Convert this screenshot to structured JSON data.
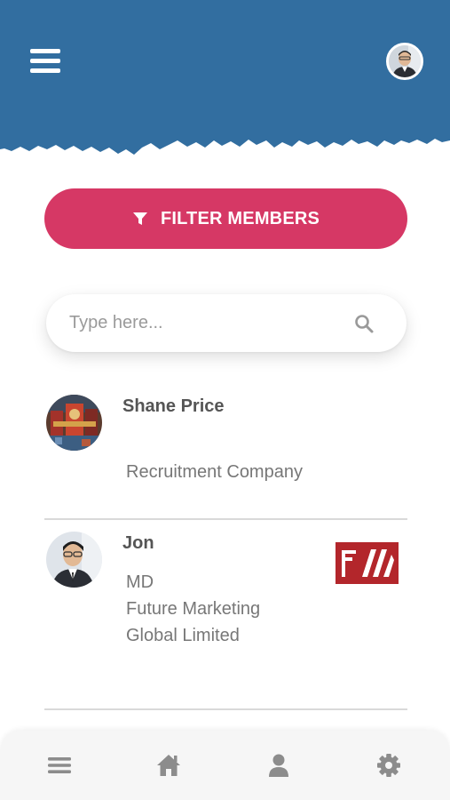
{
  "header": {
    "menu_icon": "hamburger-menu-icon",
    "avatar_icon": "user-profile-avatar",
    "colors": {
      "background": "#326ea0"
    }
  },
  "filter": {
    "label": "FILTER MEMBERS",
    "icon": "filter-funnel-icon",
    "color": "#d63865"
  },
  "search": {
    "value": "",
    "placeholder": "Type here...",
    "icon": "search-icon"
  },
  "members": [
    {
      "name": "Shane Price",
      "lines": [
        "Recruitment Company"
      ]
    },
    {
      "name": "Jon",
      "lines": [
        "MD",
        "Future Marketing",
        "Global Limited"
      ],
      "logo": "future-marketing-logo"
    }
  ],
  "bottom_nav": {
    "items": [
      "menu-icon",
      "home-icon",
      "user-icon",
      "gear-icon"
    ],
    "color": "#8c8c8c"
  }
}
